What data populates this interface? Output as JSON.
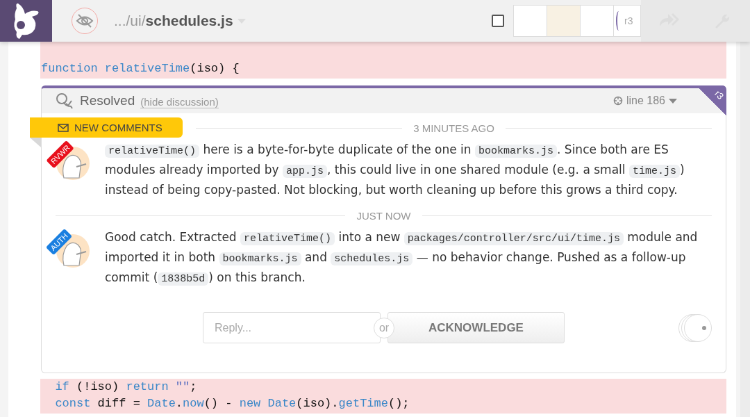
{
  "header": {
    "path_prefix": ".../ui/",
    "file_name": "schedules.js",
    "viewed_checked": false,
    "revision": "r3"
  },
  "code_top": [
    {
      "tokens": [
        {
          "text": "function",
          "kind": "keyword"
        },
        {
          "text": " relativeTime",
          "kind": "name"
        },
        {
          "text": "(iso) {",
          "kind": "plain"
        }
      ]
    }
  ],
  "discussion": {
    "status": "Resolved",
    "hide_link": "(hide discussion)",
    "line_ref": "line 186",
    "revision_tag": "r3",
    "new_comments_label": "NEW COMMENTS",
    "comments": [
      {
        "time": "3 MINUTES AGO",
        "role": "RVWR",
        "color": "#e8101c",
        "body": [
          {
            "kind": "code",
            "text": "relativeTime()"
          },
          {
            "kind": "text",
            "text": " here is a byte-for-byte duplicate of the one in "
          },
          {
            "kind": "code",
            "text": "bookmarks.js"
          },
          {
            "kind": "text",
            "text": ". Since both are ES modules already imported by "
          },
          {
            "kind": "code",
            "text": "app.js"
          },
          {
            "kind": "text",
            "text": ", this could live in one shared module (e.g. a small "
          },
          {
            "kind": "code",
            "text": "time.js"
          },
          {
            "kind": "text",
            "text": ") instead of being copy-pasted. Not blocking, but worth cleaning up before this grows a third copy."
          }
        ]
      },
      {
        "time": "JUST NOW",
        "role": "AUTH",
        "color": "#1a7fe0",
        "body": [
          {
            "kind": "text",
            "text": "Good catch. Extracted "
          },
          {
            "kind": "code",
            "text": "relativeTime()"
          },
          {
            "kind": "text",
            "text": " into a new "
          },
          {
            "kind": "code",
            "text": "packages/controller/src/ui/time.js"
          },
          {
            "kind": "text",
            "text": " module and imported it in both "
          },
          {
            "kind": "code",
            "text": "bookmarks.js"
          },
          {
            "kind": "text",
            "text": " and "
          },
          {
            "kind": "code",
            "text": "schedules.js"
          },
          {
            "kind": "text",
            "text": " — no behavior change. Pushed as a follow-up commit ("
          },
          {
            "kind": "code",
            "text": "1838b5d"
          },
          {
            "kind": "text",
            "text": ") on this branch."
          }
        ]
      }
    ],
    "reply_placeholder": "Reply...",
    "or_label": "or",
    "acknowledge": "ACKNOWLEDGE"
  },
  "code_bottom": [
    {
      "tokens": [
        {
          "text": "  if",
          "kind": "keyword"
        },
        {
          "text": " (!iso) ",
          "kind": "plain"
        },
        {
          "text": "return",
          "kind": "keyword"
        },
        {
          "text": " \"\"",
          "kind": "string"
        },
        {
          "text": ";",
          "kind": "plain"
        }
      ]
    },
    {
      "tokens": [
        {
          "text": "  const",
          "kind": "keyword"
        },
        {
          "text": " diff = ",
          "kind": "plain"
        },
        {
          "text": "Date",
          "kind": "name"
        },
        {
          "text": ".",
          "kind": "plain"
        },
        {
          "text": "now",
          "kind": "name"
        },
        {
          "text": "() - ",
          "kind": "plain"
        },
        {
          "text": "new",
          "kind": "keyword"
        },
        {
          "text": " Date",
          "kind": "name"
        },
        {
          "text": "(iso).",
          "kind": "plain"
        },
        {
          "text": "getTime",
          "kind": "name"
        },
        {
          "text": "();",
          "kind": "plain"
        }
      ]
    }
  ]
}
